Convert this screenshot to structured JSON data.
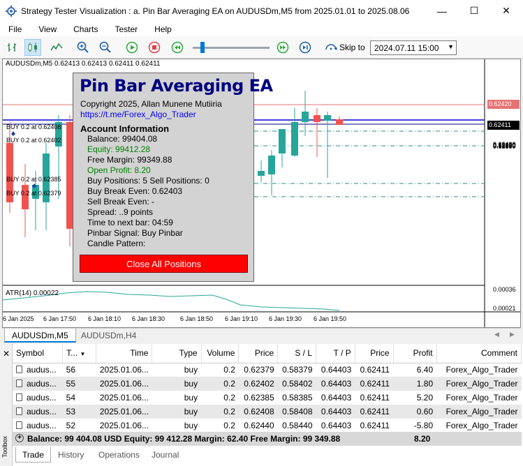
{
  "window": {
    "title": "Strategy Tester Visualization : a. Pin Bar Averaging EA on AUDUSDm,M5 from 2025.01.01 to 2025.08.06",
    "minimize": "—",
    "maximize": "☐",
    "close": "✕"
  },
  "menu": [
    "File",
    "View",
    "Charts",
    "Tester",
    "Help"
  ],
  "toolbar": {
    "skip_label": "Skip to",
    "skip_value": "2024.07.11 15:00"
  },
  "chart": {
    "header": "AUDUSDm,M5  0.62413 0.62413 0.62411 0.62411",
    "price_ticks": [
      {
        "label": "0.62430",
        "price": 0.6243
      },
      {
        "label": "0.62410",
        "price": 0.6241
      },
      {
        "label": "0.62400",
        "price": 0.624
      },
      {
        "label": "0.62390",
        "price": 0.6239
      },
      {
        "label": "0.62380",
        "price": 0.6238
      },
      {
        "label": "0.62370",
        "price": 0.6237
      },
      {
        "label": "0.62360",
        "price": 0.6236
      },
      {
        "label": "0.62350",
        "price": 0.6235
      }
    ],
    "ask_label": "0.62420",
    "bid_label": "0.62411",
    "time_labels": [
      "6 Jan 2025",
      "6 Jan 17:50",
      "6 Jan 18:10",
      "6 Jan 18:30",
      "6 Jan 18:50",
      "6 Jan 19:10",
      "6 Jan 19:30",
      "6 Jan 19:50"
    ],
    "trade_labels": [
      {
        "text": "BUY 0.2 at 0.62408",
        "price": 0.62408
      },
      {
        "text": "BUY 0.2 at 0.62402",
        "price": 0.62402
      },
      {
        "text": "BUY 0.2 at 0.62385",
        "price": 0.62385
      },
      {
        "text": "BUY 0.2 at 0.62379",
        "price": 0.62379
      }
    ],
    "atr_label": "ATR(14) 0.00022",
    "atr_ticks": [
      "0.00036",
      "0.00021"
    ],
    "colors": {
      "bull": "#26a69a",
      "bear": "#ef5350",
      "bid": "#0000cd",
      "ask": "#e57373"
    }
  },
  "panel": {
    "title": "Pin Bar Averaging EA",
    "copyright": "Copyright 2025, Allan Munene Mutiiria",
    "link": "https://t.me/Forex_Algo_Trader",
    "account_header": "Account Information",
    "balance": "Balance: 99404.08",
    "equity": "Equity: 99412.28",
    "free_margin": "Free Margin: 99349.88",
    "open_profit": "Open Profit: 8.20",
    "positions": "Buy Positions: 5 Sell Positions: 0",
    "buy_be": "Buy Break Even: 0.62403",
    "sell_be": "Sell Break Even: -",
    "spread": "Spread: ..9 points",
    "next_bar": "Time to next bar: 04:59",
    "pinbar": "Pinbar Signal: Buy Pinbar",
    "candle": "Candle Pattern:",
    "close_all": "Close All Positions"
  },
  "chart_tabs": [
    "AUDUSDm,M5",
    "AUDUSDm,H4"
  ],
  "orders": {
    "headers": [
      "Symbol",
      "T...",
      "Time",
      "Type",
      "Volume",
      "Price",
      "S / L",
      "T / P",
      "Price",
      "Profit",
      "Comment"
    ],
    "rows": [
      [
        "audus...",
        "56",
        "2025.01.06...",
        "buy",
        "0.2",
        "0.62379",
        "0.58379",
        "0.64403",
        "0.62411",
        "6.40",
        "Forex_Algo_Trader"
      ],
      [
        "audus...",
        "55",
        "2025.01.06...",
        "buy",
        "0.2",
        "0.62402",
        "0.58402",
        "0.64403",
        "0.62411",
        "1.80",
        "Forex_Algo_Trader"
      ],
      [
        "audus...",
        "54",
        "2025.01.06...",
        "buy",
        "0.2",
        "0.62385",
        "0.58385",
        "0.64403",
        "0.62411",
        "5.20",
        "Forex_Algo_Trader"
      ],
      [
        "audus...",
        "53",
        "2025.01.06...",
        "buy",
        "0.2",
        "0.62408",
        "0.58408",
        "0.64403",
        "0.62411",
        "0.60",
        "Forex_Algo_Trader"
      ],
      [
        "audus...",
        "52",
        "2025.01.06...",
        "buy",
        "0.2",
        "0.62440",
        "0.58440",
        "0.64403",
        "0.62411",
        "-5.80",
        "Forex_Algo_Trader"
      ]
    ],
    "summary": "Balance: 99 404.08 USD  Equity: 99 412.28  Margin: 62.40  Free Margin: 99 349.88",
    "summary_profit": "8.20"
  },
  "bottom_tabs": [
    "Trade",
    "History",
    "Operations",
    "Journal"
  ],
  "toolbox_label": "Toolbox"
}
